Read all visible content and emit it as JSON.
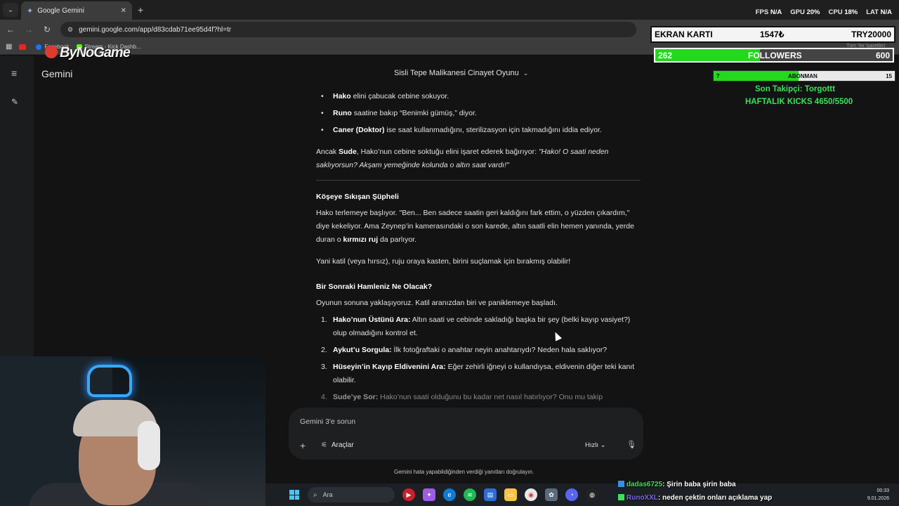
{
  "browser": {
    "tab_title": "Google Gemini",
    "url": "gemini.google.com/app/d83cdab71ee95d4f?hl=tr",
    "bookmarks": [
      "Facebook",
      "Stream - Kick Dashb..."
    ],
    "bookmarks_right": "Tüm Yer İşaretleri"
  },
  "gemini": {
    "app_title": "Gemini",
    "conversation_title": "Sisli Tepe Malikanesi Cinayet Oyunu",
    "input_placeholder": "Gemini 3'e sorun",
    "tools_label": "Araçlar",
    "model_label": "Hızlı",
    "disclaimer": "Gemini hata yapabildiğinden verdiği yanıtları doğrulayın."
  },
  "message": {
    "bullets": [
      {
        "name": "Hako",
        "text": " elini çabucak cebine sokuyor."
      },
      {
        "name": "Runo",
        "text": " saatine bakıp “Benimki gümüş,” diyor."
      },
      {
        "name": "Caner (Doktor)",
        "text": " ise saat kullanmadığını, sterilizasyon için takmadığını iddia ediyor."
      }
    ],
    "p1_a": "Ancak ",
    "p1_name": "Sude",
    "p1_b": ", Hako’nun cebine soktuğu elini işaret ederek bağırıyor: ",
    "p1_quote": "\"Hako! O saati neden saklıyorsun? Akşam yemeğinde kolunda o altın saat vardı!\"",
    "h1": "Köşeye Sıkışan Şüpheli",
    "p2_a": "Hako terlemeye başlıyor. \"Ben... Ben sadece saatin geri kaldığını fark ettim, o yüzden çıkardım,\" diye kekeliyor. Ama Zeynep’in kamerasındaki o son karede, altın saatli elin hemen yanında, yerde duran o ",
    "p2_bold": "kırmızı ruj",
    "p2_b": " da parlıyor.",
    "p3": "Yani katil (veya hırsız), ruju oraya kasten, birini suçlamak için bırakmış olabilir!",
    "h2": "Bir Sonraki Hamleniz Ne Olacak?",
    "p4": "Oyunun sonuna yaklaşıyoruz. Katil aranızdan biri ve paniklemeye başladı.",
    "items": [
      {
        "n": "1.",
        "title": "Hako’nun Üstünü Ara:",
        "text": " Altın saati ve cebinde sakladığı başka bir şey (belki kayıp vasiyet?) olup olmadığını kontrol et."
      },
      {
        "n": "2.",
        "title": "Aykut’u Sorgula:",
        "text": " İlk fotoğraftaki o anahtar neyin anahtarıydı? Neden hala saklıyor?"
      },
      {
        "n": "3.",
        "title": "Hüseyin’in Kayıp Eldivenini Ara:",
        "text": " Eğer zehirli iğneyi o kullandıysa, eldivenin diğer teki kanıt olabilir."
      },
      {
        "n": "4.",
        "title": "Sude’ye Sor:",
        "text": " Hako’nun saati olduğunu bu kadar net nasıl hatırlıyor? Onu mu takip"
      }
    ]
  },
  "overlay": {
    "stats": [
      {
        "label": "FPS",
        "value": "N/A"
      },
      {
        "label": "GPU",
        "value": "20%"
      },
      {
        "label": "CPU",
        "value": "18%"
      },
      {
        "label": "LAT",
        "value": "N/A"
      }
    ],
    "brand": "ByNoGame",
    "card_label": "EKRAN KARTI",
    "card_price": "1547₺",
    "card_goal": "TRY20000",
    "followers_current": "262",
    "followers_label": "FOLLOWERS",
    "followers_goal": "600",
    "followers_progress": 0.44,
    "sub_current": "7",
    "sub_label": "ABONMAN",
    "sub_goal": "15",
    "sub_progress": 0.47,
    "last_follower": "Son Takipçi: Torgottt",
    "weekly_kicks": "HAFTALIK KICKS 4650/5500"
  },
  "chat": [
    {
      "user": "dadas6725",
      "text": ": Şirin baba şirin baba"
    },
    {
      "user": "RunoXXL",
      "text": ": neden çektin onları açıklama yap"
    }
  ],
  "taskbar": {
    "search_label": "Ara",
    "time": "00:33",
    "date": "9.01.2026"
  }
}
